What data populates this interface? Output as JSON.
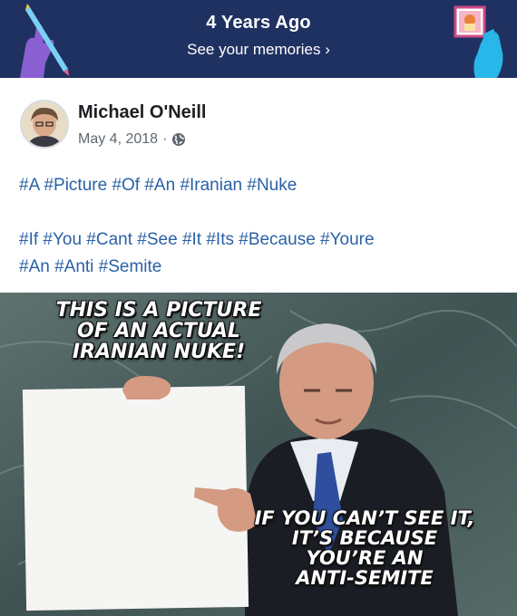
{
  "banner": {
    "title": "4 Years Ago",
    "link": "See your memories ›",
    "colors": {
      "background": "#1f3161",
      "accent_left": "#8a5fd1",
      "accent_right": "#29b6e8"
    }
  },
  "post": {
    "author": "Michael O'Neill",
    "date": "May 4, 2018",
    "separator": "·",
    "privacy_icon": "globe-icon",
    "paragraph1": "#A #Picture #Of #An #Iranian #Nuke",
    "paragraph2_line1": "#If #You #Cant #See #It #Its #Because #Youre",
    "paragraph2_line2": "#An #Anti #Semite",
    "hashtag_color": "#2a61a6"
  },
  "meme": {
    "top_line1": "THIS IS A PICTURE",
    "top_line2": "OF AN ACTUAL",
    "top_line3": "IRANIAN NUKE!",
    "bottom_line1": "IF YOU CAN’T SEE IT,",
    "bottom_line2": "IT’S BECAUSE",
    "bottom_line3": "YOU’RE AN",
    "bottom_line4": "ANTI-SEMITE"
  }
}
